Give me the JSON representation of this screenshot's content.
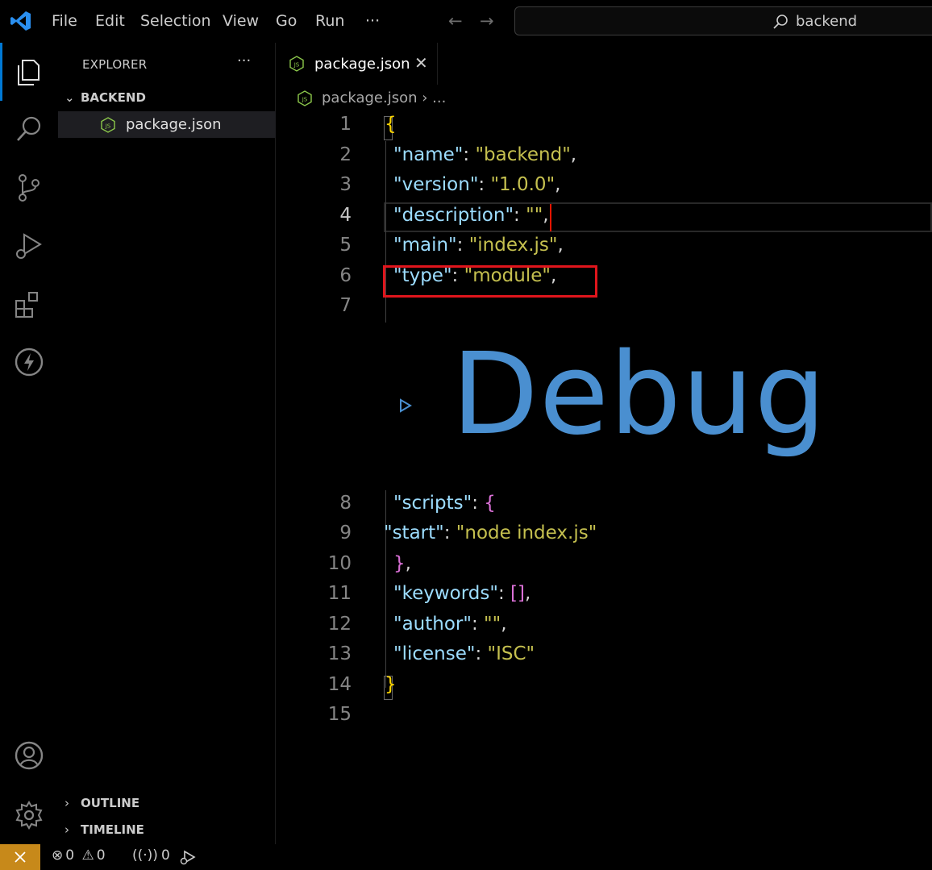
{
  "titlebar": {
    "menus": [
      "File",
      "Edit",
      "Selection",
      "View",
      "Go",
      "Run",
      "···"
    ],
    "search_text": "backend"
  },
  "sidebar": {
    "title": "EXPLORER",
    "more": "···",
    "folder": "BACKEND",
    "file": "package.json",
    "outline": "OUTLINE",
    "timeline": "TIMELINE"
  },
  "editor": {
    "tab_label": "package.json",
    "tab_close": "✕",
    "breadcrumb": "package.json › ...",
    "js_badge": "JS",
    "line_numbers": [
      "1",
      "2",
      "3",
      "4",
      "5",
      "6",
      "7",
      "8",
      "9",
      "10",
      "11",
      "12",
      "13",
      "14",
      "15"
    ],
    "active_line": "4",
    "overlay_text": "Debug"
  },
  "code": {
    "l1_brace": "{",
    "l2_key": "\"name\"",
    "l2_val": "\"backend\"",
    "l3_key": "\"version\"",
    "l3_val": "\"1.0.0\"",
    "l4_key": "\"description\"",
    "l4_val": "\"\"",
    "l5_key": "\"main\"",
    "l5_val": "\"index.js\"",
    "l6_key": "\"type\"",
    "l6_val": "\"module\"",
    "l8_key": "\"scripts\"",
    "l8_open": "{",
    "l9_key": "\"start\"",
    "l9_val": "\"node index.js\"",
    "l10_close": "}",
    "l11_key": "\"keywords\"",
    "l11_val": "[]",
    "l12_key": "\"author\"",
    "l12_val": "\"\"",
    "l13_key": "\"license\"",
    "l13_val": "\"ISC\"",
    "l14_brace": "}",
    "colon": ": ",
    "comma": ","
  },
  "statusbar": {
    "errors": "0",
    "warnings": "0",
    "ports": "0"
  },
  "colors": {
    "accent": "#0078d4",
    "remote": "#c7891a",
    "highlight_box": "#e0151c",
    "debug_text": "#4a8fd0",
    "key": "#9cdcfe",
    "string": "#c5c04f"
  }
}
